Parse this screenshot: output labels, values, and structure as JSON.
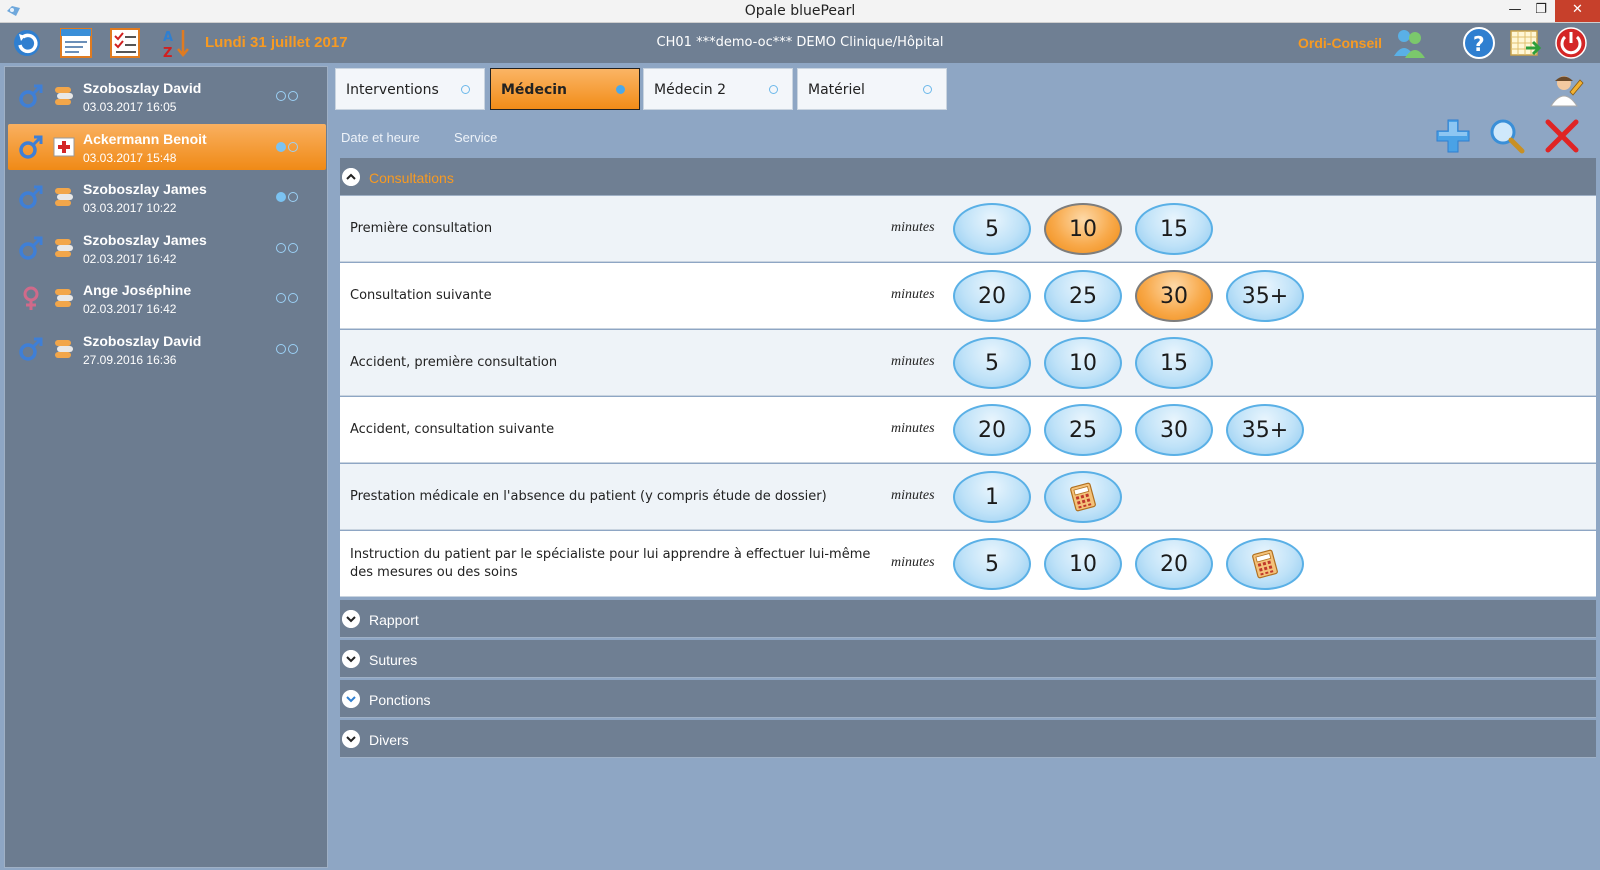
{
  "window": {
    "title": "Opale bluePearl",
    "minimize": "—",
    "maximize": "❐",
    "close": "✕"
  },
  "toolbar": {
    "date": "Lundi 31 juillet 2017",
    "center": "CH01 ***demo-oc*** DEMO Clinique/Hôpital",
    "company": "Ordi-Conseil",
    "icons": [
      "refresh-icon",
      "browser-window-icon",
      "task-list-icon",
      "sort-az-icon",
      "users-icon",
      "help-icon",
      "calendar-export-icon",
      "power-icon"
    ]
  },
  "patients": [
    {
      "name": "Szoboszlay David",
      "date": "03.03.2017  16:05",
      "sex": "male",
      "dots": [
        false,
        false
      ],
      "active": false
    },
    {
      "name": "Ackermann Benoit",
      "date": "03.03.2017  15:48",
      "sex": "male",
      "dots": [
        true,
        false
      ],
      "active": true
    },
    {
      "name": "Szoboszlay James",
      "date": "03.03.2017  10:22",
      "sex": "male",
      "dots": [
        true,
        false
      ],
      "active": false
    },
    {
      "name": "Szoboszlay James",
      "date": "02.03.2017  16:42",
      "sex": "male",
      "dots": [
        false,
        false
      ],
      "active": false
    },
    {
      "name": "Ange Joséphine",
      "date": "02.03.2017  16:42",
      "sex": "female",
      "dots": [
        false,
        false
      ],
      "active": false
    },
    {
      "name": "Szoboszlay David",
      "date": "27.09.2016  16:36",
      "sex": "male",
      "dots": [
        false,
        false
      ],
      "active": false
    }
  ],
  "tabs": [
    {
      "label": "Interventions",
      "active": false
    },
    {
      "label": "Médecin",
      "active": true
    },
    {
      "label": "Médecin 2",
      "active": false
    },
    {
      "label": "Matériel",
      "active": false
    }
  ],
  "sublinks": {
    "date": "Date et heure",
    "service": "Service"
  },
  "sections": {
    "consultations": "Consultations",
    "rapport": "Rapport",
    "sutures": "Sutures",
    "ponctions": "Ponctions",
    "divers": "Divers"
  },
  "unit": "minutes",
  "rows": [
    {
      "label": "Première consultation",
      "buttons": [
        "5",
        "10",
        "15"
      ],
      "selected": "10"
    },
    {
      "label": "Consultation suivante",
      "buttons": [
        "20",
        "25",
        "30",
        "35+"
      ],
      "selected": "30"
    },
    {
      "label": "Accident, première consultation",
      "buttons": [
        "5",
        "10",
        "15"
      ],
      "selected": ""
    },
    {
      "label": "Accident, consultation suivante",
      "buttons": [
        "20",
        "25",
        "30",
        "35+"
      ],
      "selected": ""
    },
    {
      "label": "Prestation médicale en l'absence du patient (y compris étude de dossier)",
      "buttons": [
        "1",
        "calculator"
      ],
      "selected": ""
    },
    {
      "label": "Instruction du patient par le spécialiste pour lui apprendre à effectuer lui-même des mesures ou des soins",
      "buttons": [
        "5",
        "10",
        "20",
        "calculator"
      ],
      "selected": ""
    }
  ],
  "colors": {
    "accent": "#f79a22",
    "toolbar": "#6f7f93",
    "background": "#8ea6c4",
    "pill_border": "#5ab0e6"
  }
}
